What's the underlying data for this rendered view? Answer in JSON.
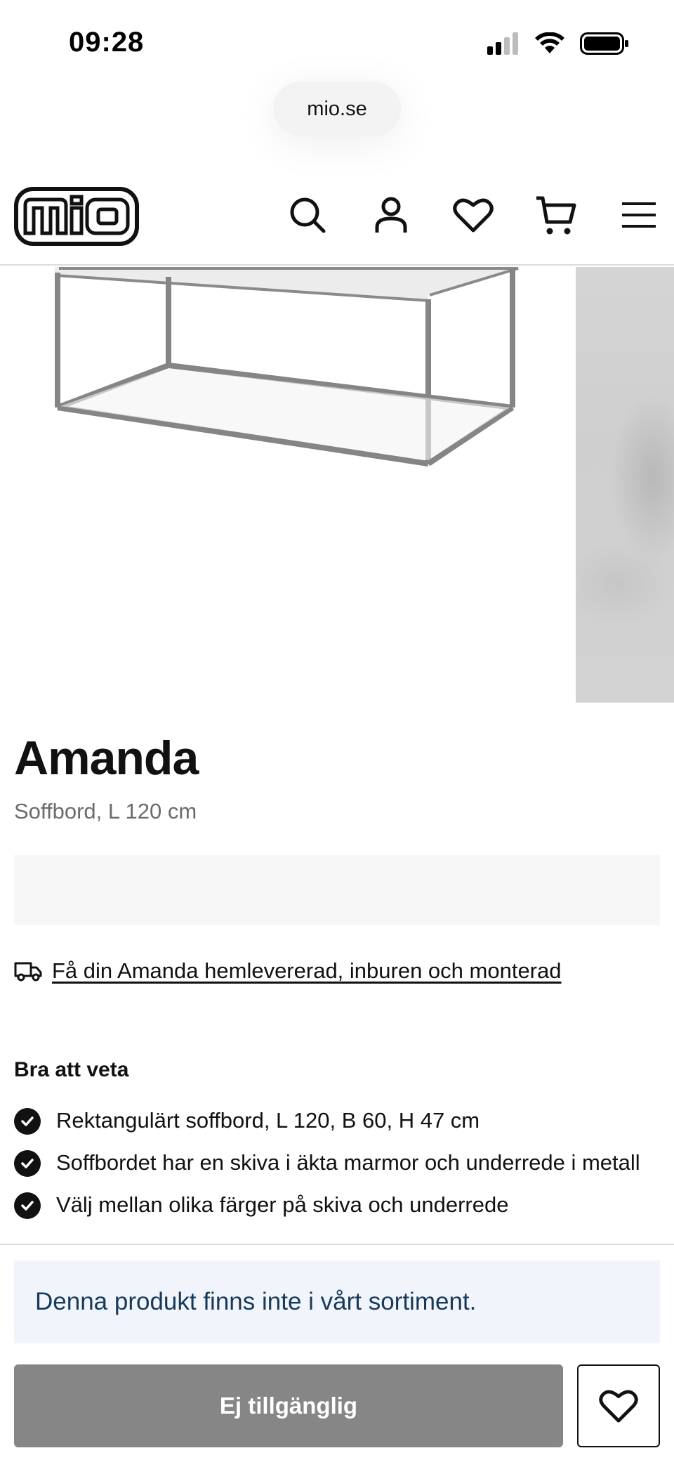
{
  "status_bar": {
    "time": "09:28",
    "icons": [
      "signal-icon",
      "wifi-icon",
      "battery-icon"
    ]
  },
  "browser": {
    "url": "mio.se"
  },
  "header": {
    "logo_text": "mio",
    "icons": [
      "search-icon",
      "account-icon",
      "heart-icon",
      "cart-icon",
      "menu-icon"
    ]
  },
  "product": {
    "title": "Amanda",
    "subtitle": "Soffbord, L 120 cm",
    "delivery_link": "Få din Amanda hemlevererad, inburen och monterad",
    "good_to_know_heading": "Bra att veta",
    "features": [
      "Rektangulärt soffbord, L 120, B 60, H 47 cm",
      "Soffbordet har en skiva i äkta marmor och underrede i metall",
      "Välj mellan olika färger på skiva och underrede"
    ]
  },
  "bottom_bar": {
    "notice": "Denna produkt finns inte i vårt sortiment.",
    "unavailable_button": "Ej tillgänglig"
  },
  "colors": {
    "text": "#111111",
    "muted": "#6b6b6b",
    "notice_bg": "#f1f5fb",
    "notice_text": "#173a5a",
    "disabled_button": "#868686"
  }
}
